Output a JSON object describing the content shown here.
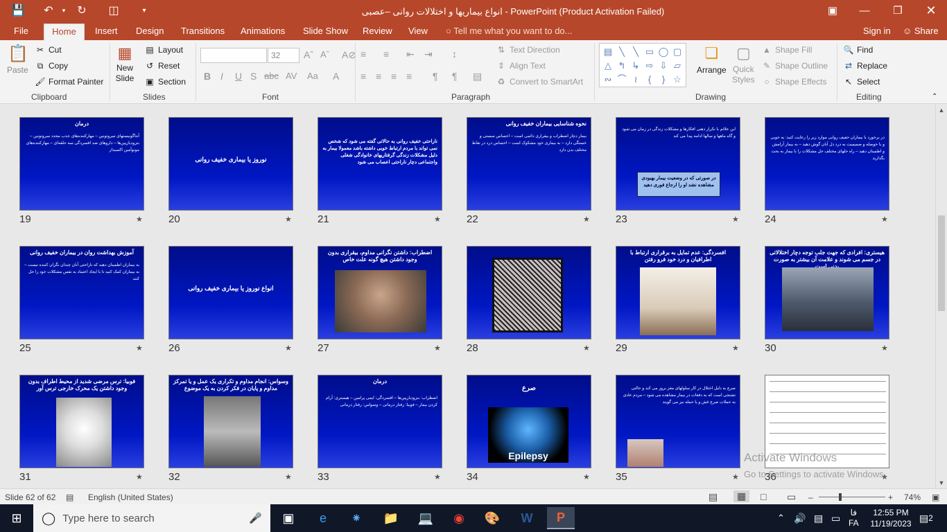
{
  "window": {
    "title": "انواع بیماریها و اختلالات روانی –عصبی  -  PowerPoint (Product Activation Failed)"
  },
  "tabs": [
    {
      "label": "File"
    },
    {
      "label": "Home"
    },
    {
      "label": "Insert"
    },
    {
      "label": "Design"
    },
    {
      "label": "Transitions"
    },
    {
      "label": "Animations"
    },
    {
      "label": "Slide Show"
    },
    {
      "label": "Review"
    },
    {
      "label": "View"
    }
  ],
  "tell_me": "Tell me what you want to do...",
  "account": {
    "sign_in": "Sign in",
    "share": "Share"
  },
  "ribbon": {
    "clipboard": {
      "label": "Clipboard",
      "paste": "Paste",
      "cut": "Cut",
      "copy": "Copy",
      "format_painter": "Format Painter"
    },
    "slides": {
      "label": "Slides",
      "new_slide": "New",
      "new_slide2": "Slide",
      "layout": "Layout",
      "reset": "Reset",
      "section": "Section"
    },
    "font": {
      "label": "Font",
      "size": "32"
    },
    "paragraph": {
      "label": "Paragraph",
      "text_direction": "Text Direction",
      "align_text": "Align Text",
      "smartart": "Convert to SmartArt"
    },
    "drawing": {
      "label": "Drawing",
      "arrange": "Arrange",
      "quick_styles": "Quick",
      "quick_styles2": "Styles",
      "shape_fill": "Shape Fill",
      "shape_outline": "Shape Outline",
      "shape_effects": "Shape Effects"
    },
    "editing": {
      "label": "Editing",
      "find": "Find",
      "replace": "Replace",
      "select": "Select"
    }
  },
  "slides": [
    {
      "num": "19",
      "title": "درمان",
      "body": "آنتاگونیستهای سروتونین – مهارکننده‌های جذب مجدد سروتونین – بنزودیازپین‌ها – داروهای ضد افسردگی سه حلقه‌ای – مهارکننده‌های مونوآمین اکسیداز"
    },
    {
      "num": "20",
      "center": "نوروز یا بیماری خفیف روانی"
    },
    {
      "num": "21",
      "body": "ناراحتی خفیف روانی به حالاتی گفته می شود که شخص نمی تواند با مردم ارتباط خوبی داشته باشد معمولا بیمار به دلیل مشکلات زندگی گرفتاریهای خانوادگی شغلی واجتماعی دچار ناراحتی اعصاب می شود"
    },
    {
      "num": "22",
      "title": "نحوه شناسایی بیماران خفیف روانی",
      "body": "بیمار دچار اضطراب و بیقراری دائمی است – احساس سستی و خستگی دارد – به بیماری خود مشکوک است – احساس درد در نقاط مختلف بدن دارد"
    },
    {
      "num": "23",
      "body": "این علائم با تکرار ذهنی افکارها و مشکلات زندگی در زمان می شود و گاه ماهها و سالها ادامه پیدا می کند",
      "box": "در صورتی که در وضعیت بیمار بهبودی مشاهده نشد او را ارجاع فوری دهید"
    },
    {
      "num": "24",
      "body": "در برخورد با بیماران خفیف روانی موارد زیر را رعایت کنید: به خوبی و با حوصله و صمیمیت به درد دل آنان گوش دهید – به بیمار آرامش و اطمینان دهید – راه حلهای مختلف حل مشکلات را با بیمار به بحث بگذارید"
    },
    {
      "num": "25",
      "title": "آموزش بهداشت روان در بیماران خفیف روانی",
      "body": "به بیماران اطمینان دهید که ناراحتی آنان چندان نگران کننده نیست – به بیماران کمک کنید تا با ایجاد اعتماد به نفس مشکلات خود را حل کنند"
    },
    {
      "num": "26",
      "center": "انواع نوروز یا بیماری خفیف روانی"
    },
    {
      "num": "27",
      "title": "اضطراب: داشتن نگرانی مداوم، بیقراری بدون وجود داشتن هیچ گونه علت خاص"
    },
    {
      "num": "28"
    },
    {
      "num": "29",
      "title": "افسردگی: عدم تمایل به برقراری ارتباط با اطرافیان و درد خود فرو رفتن"
    },
    {
      "num": "30",
      "title": "هیستری: افرادی که جهت جلب توجه دچار اختلالاتی در جسم می شوند و علامت آن بیشتر به صورت بدنی است"
    },
    {
      "num": "31",
      "title": "فوبیا: ترس مرضی شدید از محیط اطراف بدون وجود داشتن یک محرک خارجی ترس آور"
    },
    {
      "num": "32",
      "title": "وسواس: انجام مداوم و تکراری یک عمل و یا تمرکز مداوم و پایان در فکر کردن به یک موضوع"
    },
    {
      "num": "33",
      "title": "درمان",
      "body": "اضطراب: بنزودیازپین‌ها – افسردگی: ایمی پرامین – هیستری: آرام کردن بیمار – فوبیا: رفتار درمانی – وسواس: رفتار درمانی"
    },
    {
      "num": "34",
      "title": "صرع",
      "img_label": "Epilepsy"
    },
    {
      "num": "35",
      "body": "صرع به دلیل اختلال در کار سلولهای مغز بروز می کند و حالتی تشنجی است که به دفعات در بیمار مشاهده می شود – مردم عادی به حملات صرع غش و یا حمله نیز می گویند"
    },
    {
      "num": "36"
    }
  ],
  "status": {
    "slide_info": "Slide 62 of 62",
    "language": "English (United States)",
    "zoom": "74%"
  },
  "watermark": {
    "line1": "Activate Windows",
    "line2": "Go to Settings to activate Windows."
  },
  "taskbar": {
    "search_placeholder": "Type here to search",
    "time": "12:55 PM",
    "date": "11/19/2023",
    "lang1": "فا",
    "lang2": "FA",
    "notifications": "2"
  }
}
